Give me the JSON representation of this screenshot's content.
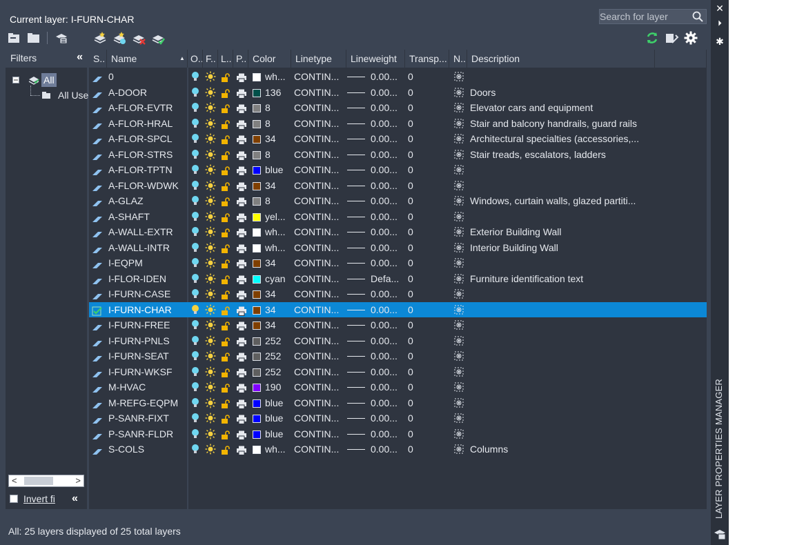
{
  "window": {
    "vertical_title": "LAYER PROPERTIES MANAGER",
    "close_glyph": "✕",
    "autohide_glyph": "⏵",
    "settings_glyph": "✱"
  },
  "header": {
    "current_layer": "Current layer: I-FURN-CHAR",
    "search_placeholder": "Search for layer"
  },
  "filters": {
    "title": "Filters",
    "collapse_glyph": "«",
    "tree": [
      {
        "label": "All"
      },
      {
        "label": "All Use"
      }
    ],
    "invert_label": "Invert fi",
    "scroll_left": "<",
    "scroll_right": ">"
  },
  "columns": [
    "S..",
    "Name",
    "O..",
    "F..",
    "L..",
    "P..",
    "Color",
    "Linetype",
    "Lineweight",
    "Transp...",
    "N..",
    "Description"
  ],
  "colors": {
    "selected_row": "#0c88d6",
    "accent_green": "#3ecf6a",
    "bulb": "#6fd6f0",
    "sun": "#f4d03f",
    "lock": "#f2b400"
  },
  "layers": [
    {
      "name": "0",
      "color": "wh...",
      "swatch": "#ffffff",
      "linetype": "CONTIN...",
      "lineweight": "0.00...",
      "transparency": "0",
      "description": ""
    },
    {
      "name": "A-DOOR",
      "color": "136",
      "swatch": "#00504a",
      "linetype": "CONTIN...",
      "lineweight": "0.00...",
      "transparency": "0",
      "description": "Doors"
    },
    {
      "name": "A-FLOR-EVTR",
      "color": "8",
      "swatch": "#808080",
      "linetype": "CONTIN...",
      "lineweight": "0.00...",
      "transparency": "0",
      "description": "Elevator cars and equipment"
    },
    {
      "name": "A-FLOR-HRAL",
      "color": "8",
      "swatch": "#808080",
      "linetype": "CONTIN...",
      "lineweight": "0.00...",
      "transparency": "0",
      "description": "Stair and balcony handrails, guard rails"
    },
    {
      "name": "A-FLOR-SPCL",
      "color": "34",
      "swatch": "#7f3f00",
      "linetype": "CONTIN...",
      "lineweight": "0.00...",
      "transparency": "0",
      "description": "Architectural specialties (accessories,..."
    },
    {
      "name": "A-FLOR-STRS",
      "color": "8",
      "swatch": "#808080",
      "linetype": "CONTIN...",
      "lineweight": "0.00...",
      "transparency": "0",
      "description": "Stair treads, escalators, ladders"
    },
    {
      "name": "A-FLOR-TPTN",
      "color": "blue",
      "swatch": "#0000ff",
      "linetype": "CONTIN...",
      "lineweight": "0.00...",
      "transparency": "0",
      "description": ""
    },
    {
      "name": "A-FLOR-WDWK",
      "color": "34",
      "swatch": "#7f3f00",
      "linetype": "CONTIN...",
      "lineweight": "0.00...",
      "transparency": "0",
      "description": ""
    },
    {
      "name": "A-GLAZ",
      "color": "8",
      "swatch": "#808080",
      "linetype": "CONTIN...",
      "lineweight": "0.00...",
      "transparency": "0",
      "description": "Windows, curtain walls, glazed partiti..."
    },
    {
      "name": "A-SHAFT",
      "color": "yel...",
      "swatch": "#ffff00",
      "linetype": "CONTIN...",
      "lineweight": "0.00...",
      "transparency": "0",
      "description": ""
    },
    {
      "name": "A-WALL-EXTR",
      "color": "wh...",
      "swatch": "#ffffff",
      "linetype": "CONTIN...",
      "lineweight": "0.00...",
      "transparency": "0",
      "description": "Exterior Building Wall"
    },
    {
      "name": "A-WALL-INTR",
      "color": "wh...",
      "swatch": "#ffffff",
      "linetype": "CONTIN...",
      "lineweight": "0.00...",
      "transparency": "0",
      "description": "Interior Building Wall"
    },
    {
      "name": "I-EQPM",
      "color": "34",
      "swatch": "#7f3f00",
      "linetype": "CONTIN...",
      "lineweight": "0.00...",
      "transparency": "0",
      "description": ""
    },
    {
      "name": "I-FLOR-IDEN",
      "color": "cyan",
      "swatch": "#00ffff",
      "linetype": "CONTIN...",
      "lineweight": "Defa...",
      "transparency": "0",
      "description": "Furniture identification text"
    },
    {
      "name": "I-FURN-CASE",
      "color": "34",
      "swatch": "#7f3f00",
      "linetype": "CONTIN...",
      "lineweight": "0.00...",
      "transparency": "0",
      "description": ""
    },
    {
      "name": "I-FURN-CHAR",
      "color": "34",
      "swatch": "#7f3f00",
      "linetype": "CONTIN...",
      "lineweight": "0.00...",
      "transparency": "0",
      "description": "",
      "current": true
    },
    {
      "name": "I-FURN-FREE",
      "color": "34",
      "swatch": "#7f3f00",
      "linetype": "CONTIN...",
      "lineweight": "0.00...",
      "transparency": "0",
      "description": ""
    },
    {
      "name": "I-FURN-PNLS",
      "color": "252",
      "swatch": "#5f5f5f",
      "linetype": "CONTIN...",
      "lineweight": "0.00...",
      "transparency": "0",
      "description": ""
    },
    {
      "name": "I-FURN-SEAT",
      "color": "252",
      "swatch": "#5f5f5f",
      "linetype": "CONTIN...",
      "lineweight": "0.00...",
      "transparency": "0",
      "description": ""
    },
    {
      "name": "I-FURN-WKSF",
      "color": "252",
      "swatch": "#5f5f5f",
      "linetype": "CONTIN...",
      "lineweight": "0.00...",
      "transparency": "0",
      "description": ""
    },
    {
      "name": "M-HVAC",
      "color": "190",
      "swatch": "#7f00ff",
      "linetype": "CONTIN...",
      "lineweight": "0.00...",
      "transparency": "0",
      "description": ""
    },
    {
      "name": "M-REFG-EQPM",
      "color": "blue",
      "swatch": "#0000ff",
      "linetype": "CONTIN...",
      "lineweight": "0.00...",
      "transparency": "0",
      "description": ""
    },
    {
      "name": "P-SANR-FIXT",
      "color": "blue",
      "swatch": "#0000ff",
      "linetype": "CONTIN...",
      "lineweight": "0.00...",
      "transparency": "0",
      "description": ""
    },
    {
      "name": "P-SANR-FLDR",
      "color": "blue",
      "swatch": "#0000ff",
      "linetype": "CONTIN...",
      "lineweight": "0.00...",
      "transparency": "0",
      "description": ""
    },
    {
      "name": "S-COLS",
      "color": "wh...",
      "swatch": "#ffffff",
      "linetype": "CONTIN...",
      "lineweight": "0.00...",
      "transparency": "0",
      "description": "Columns"
    }
  ],
  "status": "All: 25 layers displayed of 25 total layers"
}
